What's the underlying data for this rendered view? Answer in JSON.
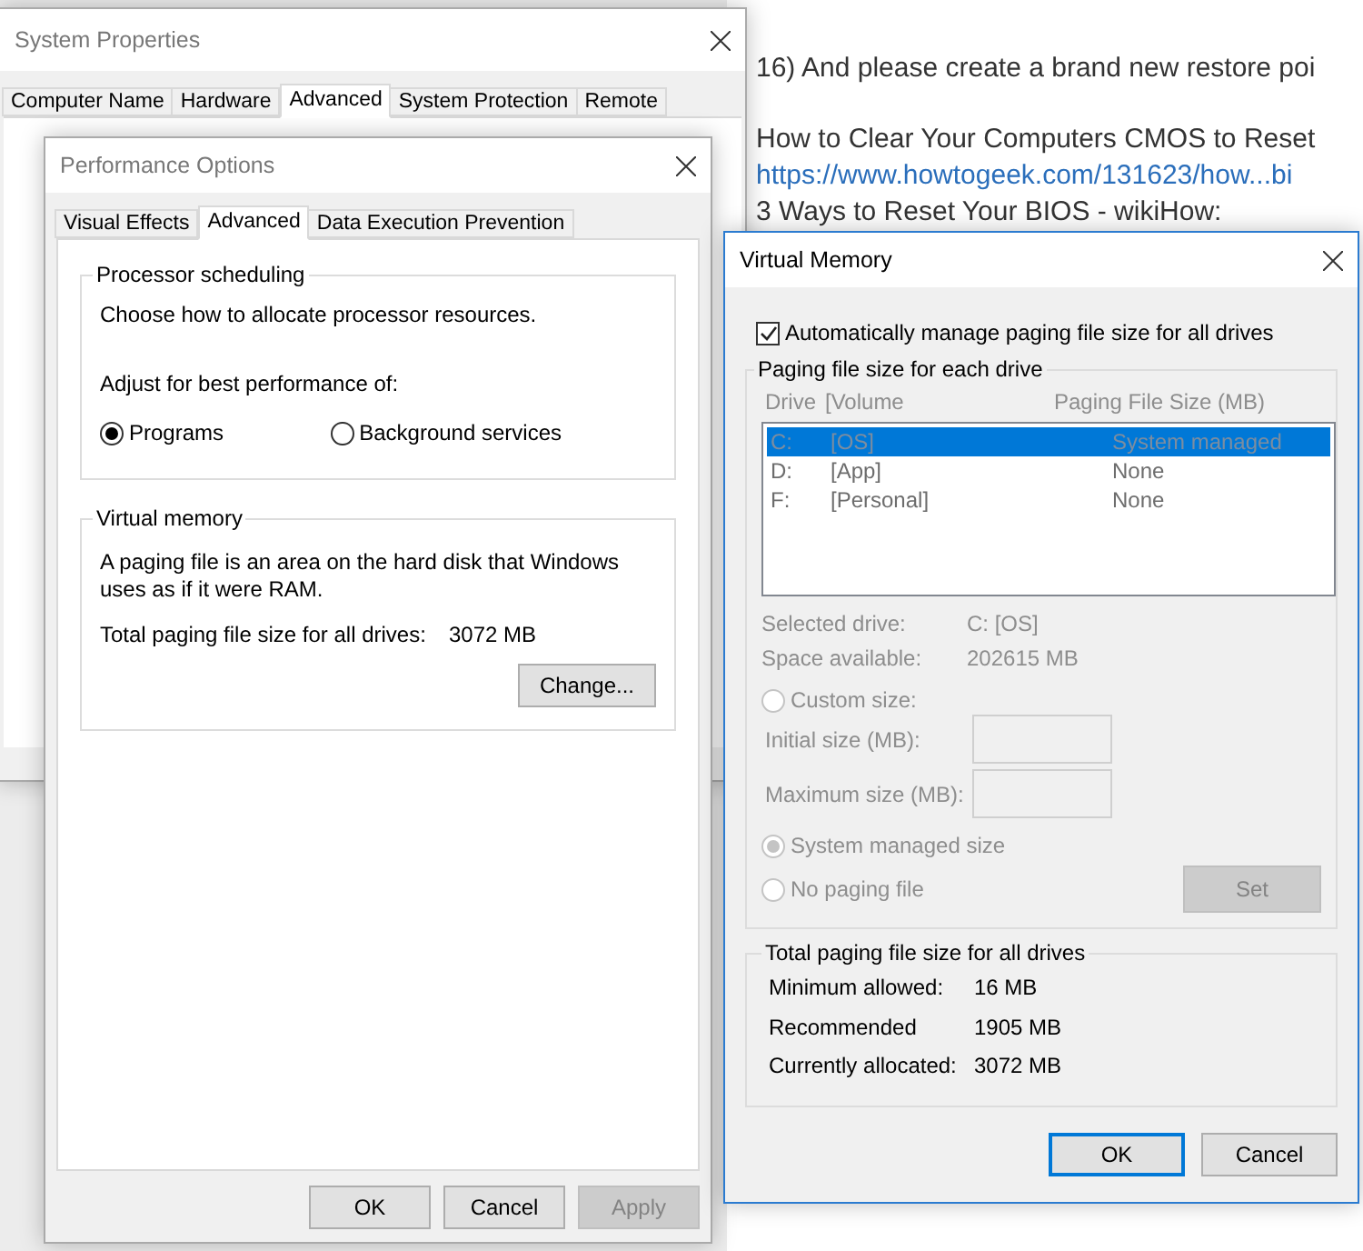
{
  "background_page": {
    "paragraphs": [
      [
        {
          "kind": "text",
          "text": "16) And please create a brand new restore poi"
        }
      ],
      [
        {
          "kind": "text",
          "text": "How to Clear Your Computers CMOS to Reset"
        },
        {
          "kind": "link",
          "text": "https://www.howtogeek.com/131623/how...bi"
        },
        {
          "kind": "text",
          "text": "3 Ways to Reset Your BIOS - wikiHow:"
        }
      ]
    ]
  },
  "system_properties": {
    "title": "System Properties",
    "tabs": [
      {
        "label": "Computer Name",
        "selected": false
      },
      {
        "label": "Hardware",
        "selected": false
      },
      {
        "label": "Advanced",
        "selected": true
      },
      {
        "label": "System Protection",
        "selected": false
      },
      {
        "label": "Remote",
        "selected": false
      }
    ]
  },
  "performance_options": {
    "title": "Performance Options",
    "tabs": [
      {
        "label": "Visual Effects",
        "selected": false
      },
      {
        "label": "Advanced",
        "selected": true
      },
      {
        "label": "Data Execution Prevention",
        "selected": false
      }
    ],
    "processor_scheduling": {
      "title": "Processor scheduling",
      "description": "Choose how to allocate processor resources.",
      "prompt": "Adjust for best performance of:",
      "options": [
        {
          "label": "Programs",
          "selected": true
        },
        {
          "label": "Background services",
          "selected": false
        }
      ]
    },
    "virtual_memory": {
      "title": "Virtual memory",
      "description": "A paging file is an area on the hard disk that Windows uses as if it were RAM.",
      "total_label": "Total paging file size for all drives:",
      "total_value": "3072 MB",
      "button": "Change..."
    },
    "buttons": [
      {
        "label": "OK",
        "disabled": false
      },
      {
        "label": "Cancel",
        "disabled": false
      },
      {
        "label": "Apply",
        "disabled": true
      }
    ]
  },
  "virtual_memory": {
    "title": "Virtual Memory",
    "auto_manage": {
      "label": "Automatically manage paging file size for all drives",
      "checked": true
    },
    "drives_group": {
      "title": "Paging file size for each drive",
      "disabled": true,
      "columns": [
        "Drive",
        "[Volume",
        "Paging File Size (MB)"
      ],
      "drives": [
        {
          "drive": "C:",
          "volume": "[OS]",
          "size": "System managed",
          "selected": true
        },
        {
          "drive": "D:",
          "volume": "[App]",
          "size": "None",
          "selected": false
        },
        {
          "drive": "F:",
          "volume": "[Personal]",
          "size": "None",
          "selected": false
        }
      ],
      "selected_drive": {
        "label": "Selected drive:",
        "value": "C:  [OS]"
      },
      "space_available": {
        "label": "Space available:",
        "value": "202615 MB"
      },
      "custom_size": {
        "label": "Custom size:",
        "selected": false
      },
      "initial_size": {
        "label": "Initial size (MB):"
      },
      "maximum_size": {
        "label": "Maximum size (MB):"
      },
      "system_managed": {
        "label": "System managed size",
        "selected": true
      },
      "no_paging": {
        "label": "No paging file",
        "selected": false
      },
      "set_button": "Set"
    },
    "totals": {
      "title": "Total paging file size for all drives",
      "rows": [
        {
          "label": "Minimum allowed:",
          "value": "16 MB"
        },
        {
          "label": "Recommended",
          "value": "1905 MB"
        },
        {
          "label": "Currently allocated:",
          "value": "3072 MB"
        }
      ]
    },
    "buttons": [
      {
        "label": "OK",
        "default": true
      },
      {
        "label": "Cancel",
        "default": false
      }
    ]
  }
}
